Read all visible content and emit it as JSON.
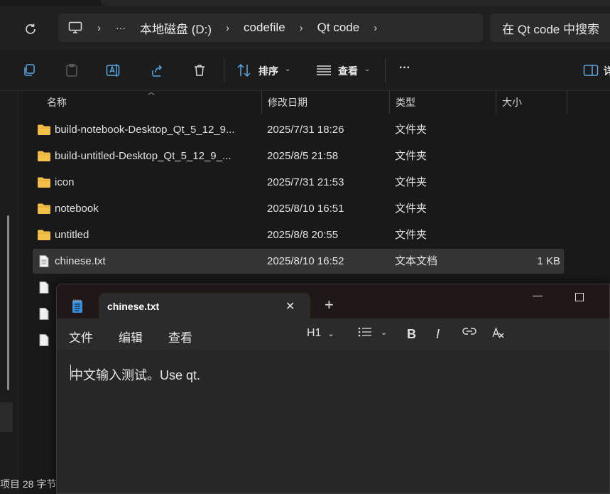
{
  "address": {
    "segments": [
      "本地磁盘 (D:)",
      "codefile",
      "Qt code"
    ],
    "overflow": "···",
    "search_placeholder": "在 Qt code 中搜索"
  },
  "toolbar": {
    "sort_label": "排序",
    "view_label": "查看",
    "more_label": "···",
    "details_label": "详"
  },
  "columns": {
    "name": "名称",
    "modified": "修改日期",
    "type": "类型",
    "size": "大小"
  },
  "files": [
    {
      "name": "build-notebook-Desktop_Qt_5_12_9...",
      "modified": "2025/7/31 18:26",
      "type": "文件夹",
      "size": "",
      "kind": "folder"
    },
    {
      "name": "build-untitled-Desktop_Qt_5_12_9_...",
      "modified": "2025/8/5 21:58",
      "type": "文件夹",
      "size": "",
      "kind": "folder"
    },
    {
      "name": "icon",
      "modified": "2025/7/31 21:53",
      "type": "文件夹",
      "size": "",
      "kind": "folder"
    },
    {
      "name": "notebook",
      "modified": "2025/8/10 16:51",
      "type": "文件夹",
      "size": "",
      "kind": "folder"
    },
    {
      "name": "untitled",
      "modified": "2025/8/8 20:55",
      "type": "文件夹",
      "size": "",
      "kind": "folder"
    },
    {
      "name": "chinese.txt",
      "modified": "2025/8/10 16:52",
      "type": "文本文档",
      "size": "1 KB",
      "kind": "file"
    }
  ],
  "status": {
    "text": "项目  28 字节"
  },
  "notepad": {
    "tab_title": "chinese.txt",
    "menu": {
      "file": "文件",
      "edit": "编辑",
      "view": "查看"
    },
    "heading_label": "H1",
    "content": "中文输入测试。Use qt."
  },
  "colors": {
    "folder": "#f4c04a",
    "notepad_icon": "#3b8fd9",
    "titlebar": "#201717"
  }
}
